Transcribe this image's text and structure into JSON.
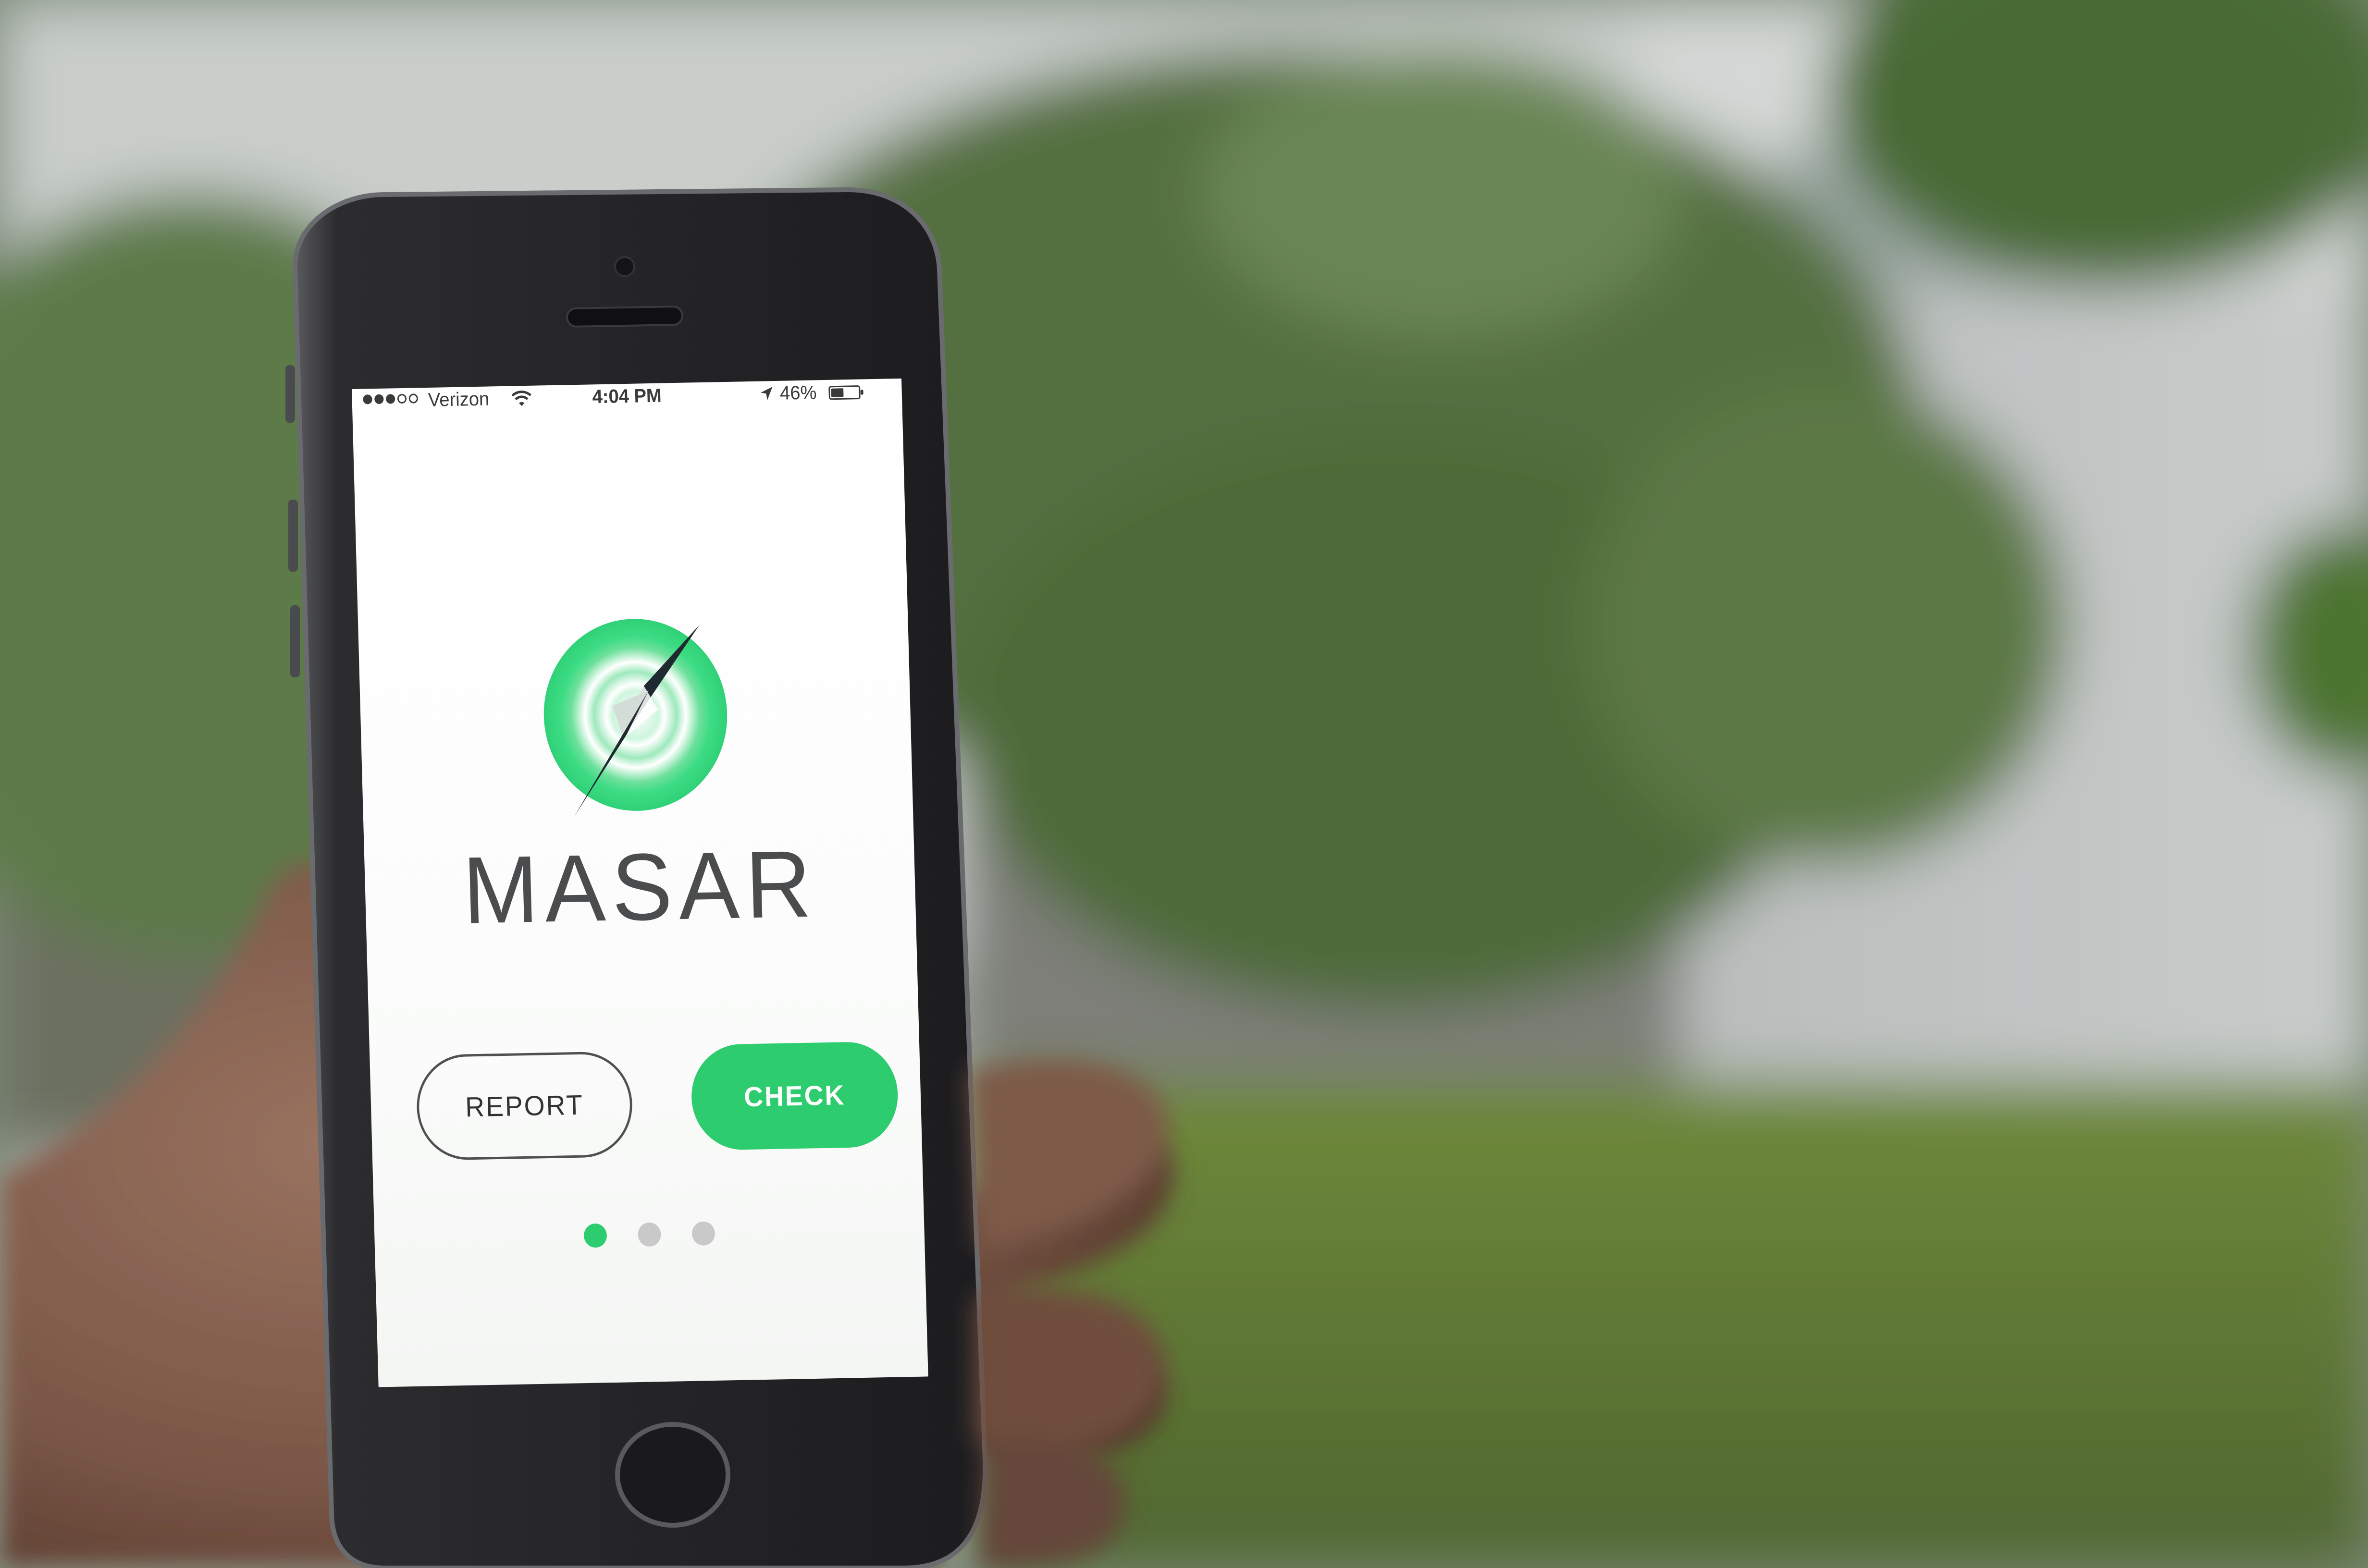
{
  "status_bar": {
    "carrier": "Verizon",
    "time": "4:04 PM",
    "battery_percent": "46%",
    "battery_level": 0.46,
    "signal_bars_filled": 3,
    "signal_bars_total": 5,
    "icons": [
      "signal-dots-icon",
      "wifi-icon",
      "location-arrow-icon",
      "battery-icon"
    ]
  },
  "app": {
    "title": "MASAR",
    "logo_icon": "compass-icon",
    "buttons": {
      "report_label": "REPORT",
      "check_label": "CHECK"
    },
    "page_dots": {
      "count": 3,
      "active_index": 0
    }
  },
  "colors": {
    "accent": "#2dcc6e",
    "logo_ring": "#3ddc84",
    "compass_needle": "#1f2a30",
    "text": "#4a4c4e"
  }
}
